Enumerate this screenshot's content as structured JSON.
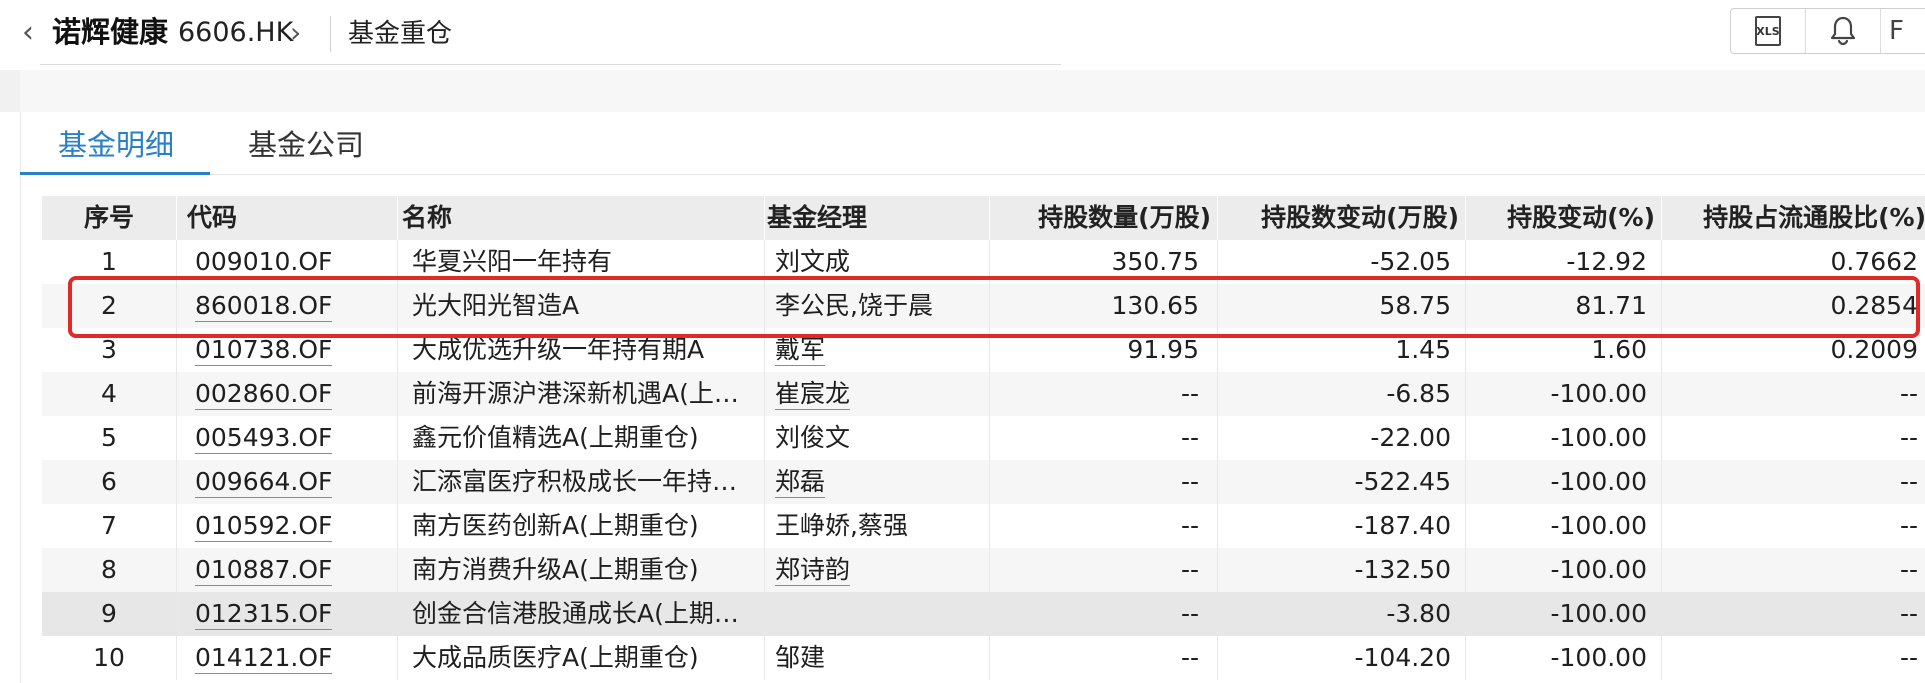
{
  "header": {
    "back_icon": "chevron-left-icon",
    "stock_name": "诺辉健康",
    "stock_code": "6606.HK",
    "chevron_icon": "chevron-right-icon",
    "section_title": "基金重仓",
    "tools": {
      "xls_label": "XLS",
      "bell_icon": "bell-icon",
      "more_label": "F"
    }
  },
  "tabs": [
    {
      "label": "基金明细",
      "active": true
    },
    {
      "label": "基金公司",
      "active": false
    }
  ],
  "table": {
    "headers": [
      "序号",
      "代码",
      "名称",
      "基金经理",
      "持股数量(万股)",
      "持股数变动(万股)",
      "持股变动(%)",
      "持股占流通股比(%)"
    ],
    "rows": [
      {
        "idx": "1",
        "code": "009010.OF",
        "name": "华夏兴阳一年持有",
        "manager": "刘文成",
        "qty": "350.75",
        "change": "-52.05",
        "pct": "-12.92",
        "ratio": "0.7662"
      },
      {
        "idx": "2",
        "code": "860018.OF",
        "name": "光大阳光智造A",
        "manager": "李公民,饶于晨",
        "qty": "130.65",
        "change": "58.75",
        "pct": "81.71",
        "ratio": "0.2854"
      },
      {
        "idx": "3",
        "code": "010738.OF",
        "name": "大成优选升级一年持有期A",
        "manager": "戴军",
        "qty": "91.95",
        "change": "1.45",
        "pct": "1.60",
        "ratio": "0.2009"
      },
      {
        "idx": "4",
        "code": "002860.OF",
        "name": "前海开源沪港深新机遇A(上…",
        "manager": "崔宸龙",
        "qty": "--",
        "change": "-6.85",
        "pct": "-100.00",
        "ratio": "--"
      },
      {
        "idx": "5",
        "code": "005493.OF",
        "name": "鑫元价值精选A(上期重仓)",
        "manager": "刘俊文",
        "qty": "--",
        "change": "-22.00",
        "pct": "-100.00",
        "ratio": "--"
      },
      {
        "idx": "6",
        "code": "009664.OF",
        "name": "汇添富医疗积极成长一年持…",
        "manager": "郑磊",
        "qty": "--",
        "change": "-522.45",
        "pct": "-100.00",
        "ratio": "--"
      },
      {
        "idx": "7",
        "code": "010592.OF",
        "name": "南方医药创新A(上期重仓)",
        "manager": "王峥娇,蔡强",
        "qty": "--",
        "change": "-187.40",
        "pct": "-100.00",
        "ratio": "--"
      },
      {
        "idx": "8",
        "code": "010887.OF",
        "name": "南方消费升级A(上期重仓)",
        "manager": "郑诗韵",
        "qty": "--",
        "change": "-132.50",
        "pct": "-100.00",
        "ratio": "--"
      },
      {
        "idx": "9",
        "code": "012315.OF",
        "name": "创金合信港股通成长A(上期…",
        "manager": "",
        "qty": "--",
        "change": "-3.80",
        "pct": "-100.00",
        "ratio": "--"
      },
      {
        "idx": "10",
        "code": "014121.OF",
        "name": "大成品质医疗A(上期重仓)",
        "manager": "邹建",
        "qty": "--",
        "change": "-104.20",
        "pct": "-100.00",
        "ratio": "--"
      }
    ]
  },
  "colors": {
    "accent": "#2a7fc7",
    "highlight": "#e02a27"
  }
}
